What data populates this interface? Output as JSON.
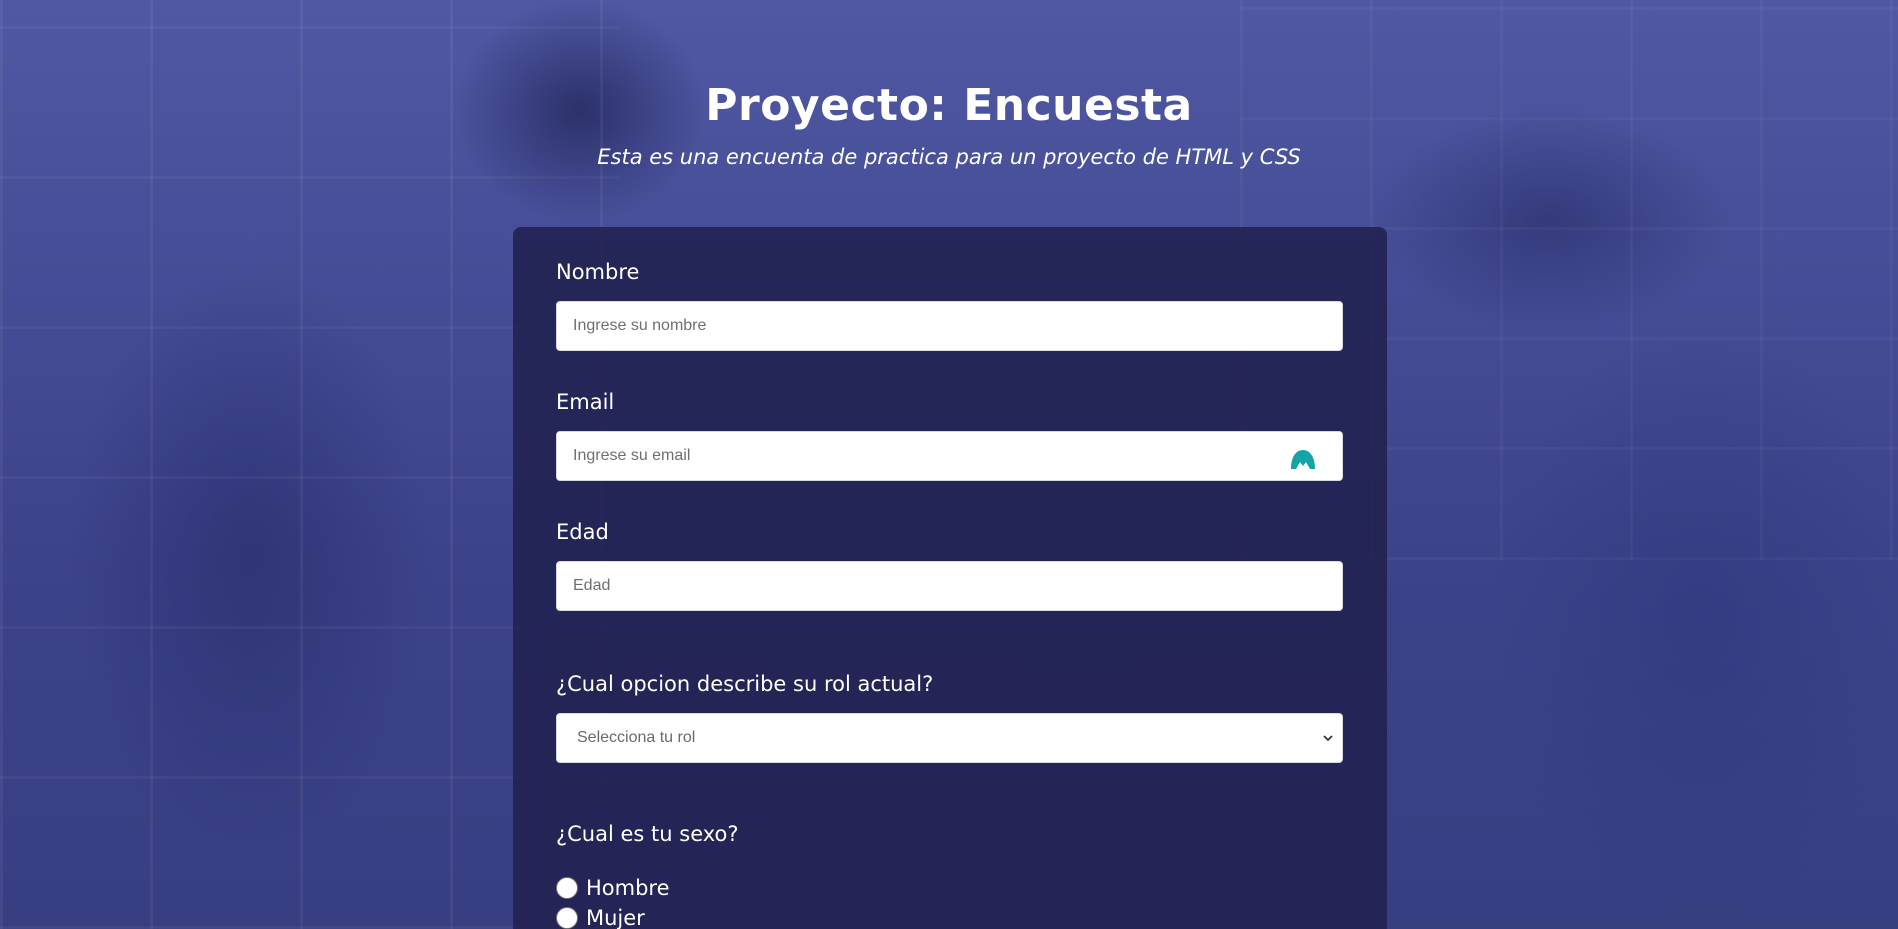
{
  "header": {
    "title": "Proyecto: Encuesta",
    "subtitle": "Esta es una encuenta de practica para un proyecto de HTML y CSS"
  },
  "form": {
    "name": {
      "label": "Nombre",
      "placeholder": "Ingrese su nombre",
      "value": ""
    },
    "email": {
      "label": "Email",
      "placeholder": "Ingrese su email",
      "value": "",
      "extension_icon": "password-manager-icon",
      "extension_icon_color": "#14a3a8"
    },
    "age": {
      "label": "Edad",
      "placeholder": "Edad",
      "value": ""
    },
    "role": {
      "label": "¿Cual opcion describe su rol actual?",
      "selected": "Selecciona tu rol"
    },
    "sex": {
      "label": "¿Cual es tu sexo?",
      "options": [
        "Hombre",
        "Mujer"
      ]
    }
  },
  "colors": {
    "card_background": "#212150",
    "text": "#ffffff",
    "background_tint": "#3a3f82"
  }
}
